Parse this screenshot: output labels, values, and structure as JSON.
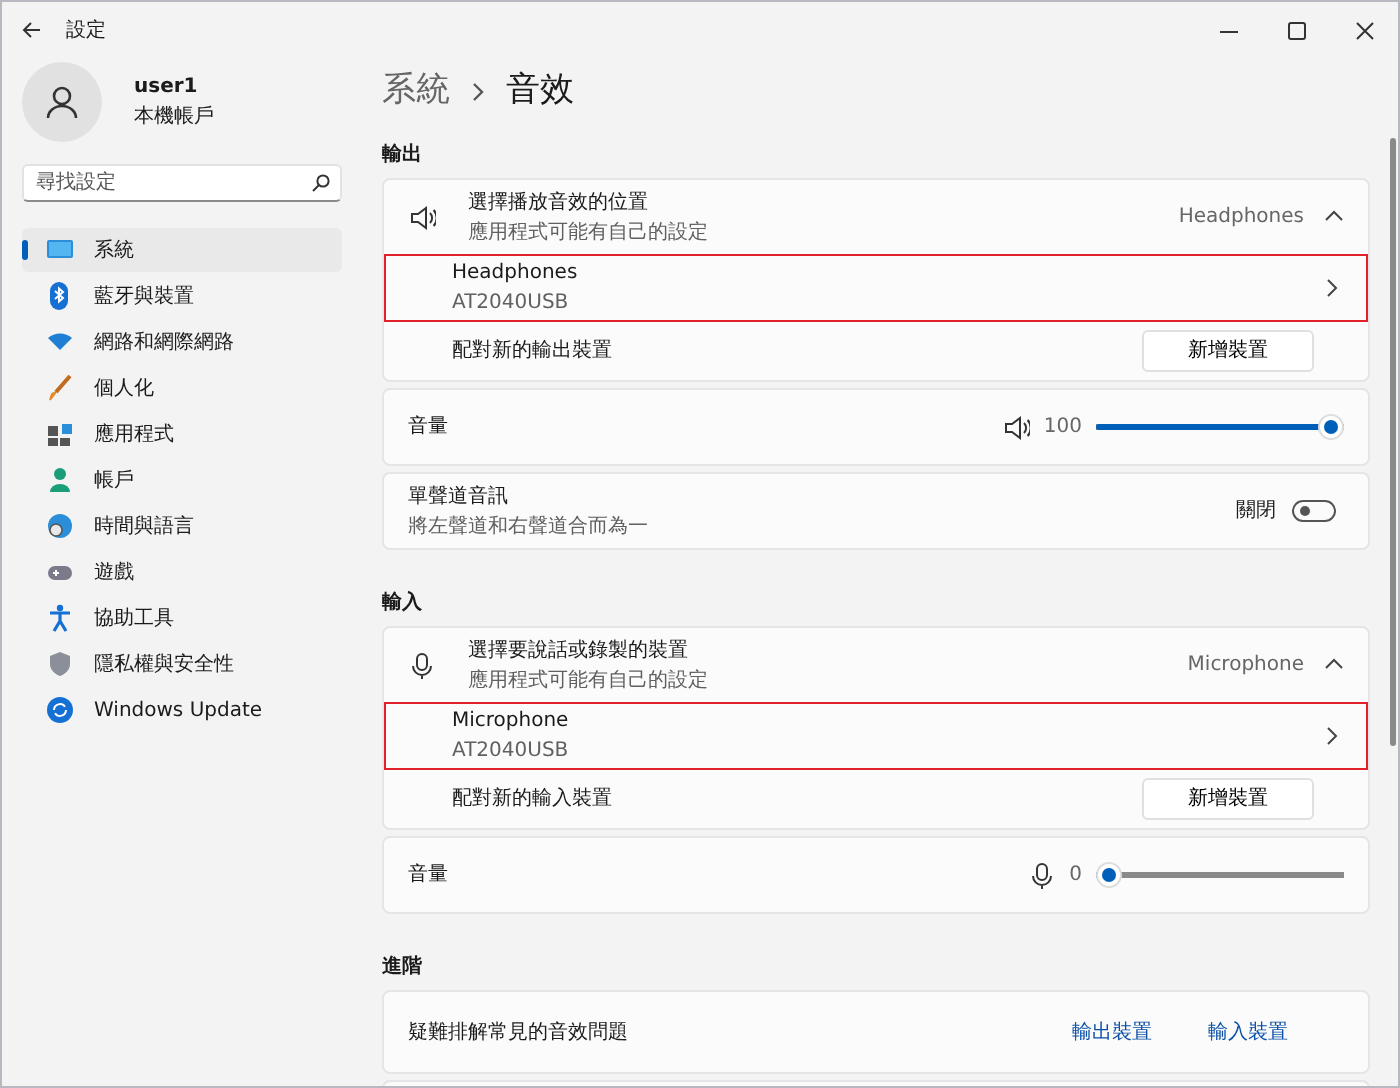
{
  "window": {
    "title": "設定"
  },
  "account": {
    "name": "user1",
    "type": "本機帳戶"
  },
  "search": {
    "placeholder": "尋找設定"
  },
  "sidebar": {
    "items": [
      {
        "label": "系統",
        "selected": true
      },
      {
        "label": "藍牙與裝置",
        "selected": false
      },
      {
        "label": "網路和網際網路",
        "selected": false
      },
      {
        "label": "個人化",
        "selected": false
      },
      {
        "label": "應用程式",
        "selected": false
      },
      {
        "label": "帳戶",
        "selected": false
      },
      {
        "label": "時間與語言",
        "selected": false
      },
      {
        "label": "遊戲",
        "selected": false
      },
      {
        "label": "協助工具",
        "selected": false
      },
      {
        "label": "隱私權與安全性",
        "selected": false
      },
      {
        "label": "Windows Update",
        "selected": false
      }
    ]
  },
  "breadcrumb": [
    "系統",
    "音效"
  ],
  "sections": [
    {
      "heading": "輸出",
      "cards": [
        {
          "kind": "device_group",
          "title": "選擇播放音效的位置",
          "subtitle": "應用程式可能有自己的設定",
          "current": "Headphones",
          "expanded": true,
          "devices": [
            {
              "name": "Headphones",
              "model": "AT2040USB",
              "highlighted": true
            }
          ],
          "pair_label": "配對新的輸出裝置",
          "pair_button": "新增裝置"
        },
        {
          "kind": "volume",
          "label": "音量",
          "reading": "100",
          "level": 1
        },
        {
          "kind": "toggle",
          "label": "單聲道音訊",
          "subtitle": "將左聲道和右聲道合而為一",
          "state_label": "關閉",
          "on": false
        }
      ]
    },
    {
      "heading": "輸入",
      "cards": [
        {
          "kind": "device_group",
          "title": "選擇要說話或錄製的裝置",
          "subtitle": "應用程式可能有自己的設定",
          "current": "Microphone",
          "expanded": true,
          "devices": [
            {
              "name": "Microphone",
              "model": "AT2040USB",
              "highlighted": true
            }
          ],
          "pair_label": "配對新的輸入裝置",
          "pair_button": "新增裝置"
        },
        {
          "kind": "volume",
          "label": "音量",
          "reading": "0",
          "level": 0
        }
      ]
    },
    {
      "heading": "進階",
      "cards": [
        {
          "kind": "links",
          "label": "疑難排解常見的音效問題",
          "links": [
            "輸出裝置",
            "輸入裝置"
          ]
        },
        {
          "kind": "partial"
        }
      ]
    }
  ]
}
